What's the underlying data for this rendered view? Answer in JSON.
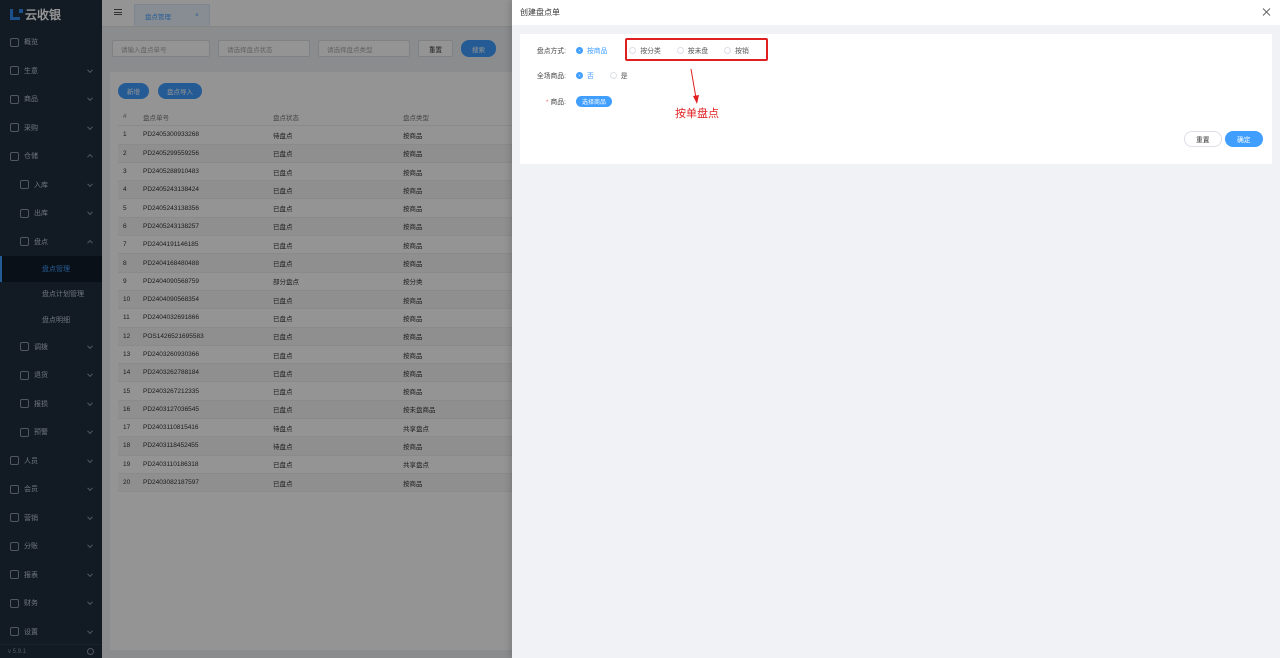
{
  "app": {
    "logo_text": "云收银",
    "version": "v 5.9.1"
  },
  "sidebar": {
    "items": [
      {
        "label": "概览",
        "level": 0,
        "chevron": false
      },
      {
        "label": "生意",
        "level": 0,
        "chevron": true
      },
      {
        "label": "商品",
        "level": 0,
        "chevron": true
      },
      {
        "label": "采购",
        "level": 0,
        "chevron": true
      },
      {
        "label": "仓储",
        "level": 0,
        "chevron": "up"
      },
      {
        "label": "入库",
        "level": 1,
        "chevron": true
      },
      {
        "label": "出库",
        "level": 1,
        "chevron": true
      },
      {
        "label": "盘点",
        "level": 1,
        "chevron": "up"
      },
      {
        "label": "盘点管理",
        "level": 2,
        "active": true
      },
      {
        "label": "盘点计划管理",
        "level": 2
      },
      {
        "label": "盘点明细",
        "level": 2
      },
      {
        "label": "调拨",
        "level": 1,
        "chevron": true
      },
      {
        "label": "退货",
        "level": 1,
        "chevron": true
      },
      {
        "label": "报损",
        "level": 1,
        "chevron": true
      },
      {
        "label": "预警",
        "level": 1,
        "chevron": true
      },
      {
        "label": "人员",
        "level": 0,
        "chevron": true
      },
      {
        "label": "会员",
        "level": 0,
        "chevron": true
      },
      {
        "label": "营销",
        "level": 0,
        "chevron": true
      },
      {
        "label": "分账",
        "level": 0,
        "chevron": true
      },
      {
        "label": "报表",
        "level": 0,
        "chevron": true
      },
      {
        "label": "财务",
        "level": 0,
        "chevron": true
      },
      {
        "label": "设置",
        "level": 0,
        "chevron": true
      }
    ]
  },
  "topbar": {
    "tab_label": "盘点管理",
    "tab_close": "×"
  },
  "filters": {
    "order_no_placeholder": "请输入盘点单号",
    "status_placeholder": "请选择盘点状态",
    "type_placeholder": "请选择盘点类型",
    "reset_label": "重置",
    "search_label": "搜索"
  },
  "actions": {
    "add_label": "新增",
    "import_label": "盘点导入"
  },
  "table": {
    "headers": [
      "#",
      "盘点单号",
      "盘点状态",
      "盘点类型"
    ],
    "rows": [
      [
        "1",
        "PD2405300933268",
        "待盘点",
        "按商品"
      ],
      [
        "2",
        "PD2405299559256",
        "已盘点",
        "按商品"
      ],
      [
        "3",
        "PD2405288910483",
        "已盘点",
        "按商品"
      ],
      [
        "4",
        "PD2405243138424",
        "已盘点",
        "按商品"
      ],
      [
        "5",
        "PD2405243138356",
        "已盘点",
        "按商品"
      ],
      [
        "6",
        "PD2405243138257",
        "已盘点",
        "按商品"
      ],
      [
        "7",
        "PD2404191146185",
        "已盘点",
        "按商品"
      ],
      [
        "8",
        "PD2404168480488",
        "已盘点",
        "按商品"
      ],
      [
        "9",
        "PD2404090568759",
        "部分盘点",
        "按分类"
      ],
      [
        "10",
        "PD2404090568354",
        "已盘点",
        "按商品"
      ],
      [
        "11",
        "PD2404032691866",
        "已盘点",
        "按商品"
      ],
      [
        "12",
        "POS1426521695583",
        "已盘点",
        "按商品"
      ],
      [
        "13",
        "PD2403260930366",
        "已盘点",
        "按商品"
      ],
      [
        "14",
        "PD2403262788184",
        "已盘点",
        "按商品"
      ],
      [
        "15",
        "PD2403267212335",
        "已盘点",
        "按商品"
      ],
      [
        "16",
        "PD2403127036545",
        "已盘点",
        "按未盘商品"
      ],
      [
        "17",
        "PD2403110815416",
        "待盘点",
        "共享盘点"
      ],
      [
        "18",
        "PD2403118452455",
        "待盘点",
        "按商品"
      ],
      [
        "19",
        "PD2403110186318",
        "已盘点",
        "共享盘点"
      ],
      [
        "20",
        "PD2403082187597",
        "已盘点",
        "按商品"
      ]
    ]
  },
  "drawer": {
    "title": "创建盘点单",
    "method_label": "盘点方式:",
    "method_options": [
      "按商品",
      "按分类",
      "按未盘",
      "按销"
    ],
    "method_selected": "按商品",
    "all_goods_label": "全场商品:",
    "all_goods_options": [
      "否",
      "是"
    ],
    "all_goods_selected": "否",
    "goods_required_mark": "*",
    "goods_label": "商品:",
    "select_goods_label": "选择商品",
    "annotation": "按单盘点",
    "reset_label": "重置",
    "confirm_label": "确定"
  },
  "colors": {
    "primary": "#409eff",
    "sidebar_bg": "#1f2d3d",
    "annotation": "#e02020"
  }
}
